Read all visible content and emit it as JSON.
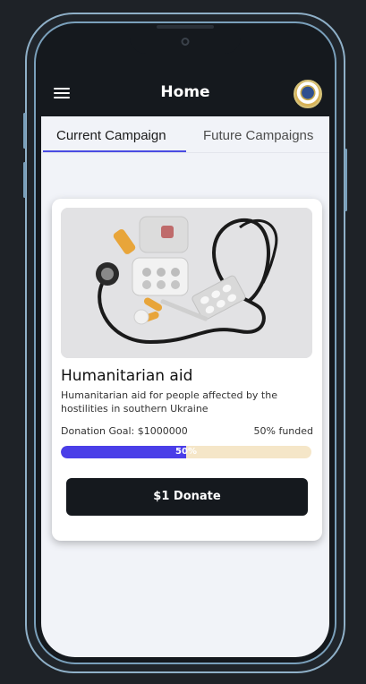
{
  "app_bar": {
    "title": "Home",
    "menu_icon": "hamburger-menu-icon",
    "avatar_icon": "profile-avatar"
  },
  "tabs": [
    {
      "label": "Current Campaign",
      "selected": true
    },
    {
      "label": "Future Campaigns",
      "selected": false
    }
  ],
  "campaign": {
    "image": "medical-supplies-photo",
    "title": "Humanitarian aid",
    "description": "Humanitarian aid for people affected by the hostilities in southern Ukraine",
    "goal_text": "Donation Goal: $1000000",
    "funded_text": "50% funded",
    "progress_percent": 50,
    "progress_label": "50%",
    "donate_label": "$1 Donate"
  },
  "colors": {
    "accent": "#4a3ee8",
    "progress_track": "#f5e6c8",
    "app_bar": "#15191e",
    "screen_bg": "#f1f3f8"
  }
}
